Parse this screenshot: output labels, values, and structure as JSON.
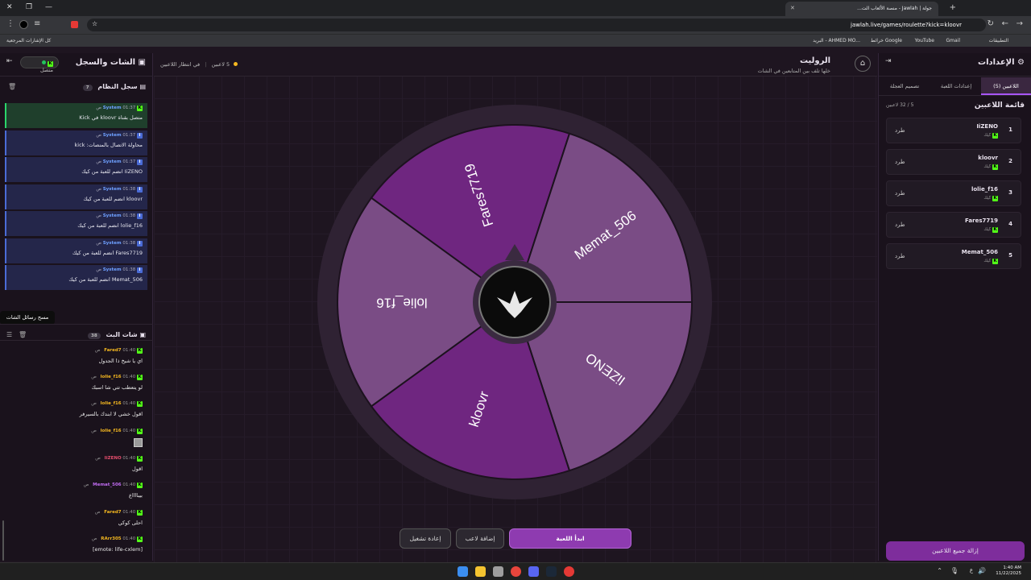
{
  "browser": {
    "tab_title": "جولة | Jawlah - منصة الألعاب الت...",
    "url": "jawlah.live/games/roulette?kick=kloovr",
    "bookmarks": [
      "التطبيقات",
      "Gmail",
      "YouTube",
      "خرائط Google",
      "البريد - AHMED MO..."
    ],
    "bookmarks_left": "كل الإشارات المرجعية"
  },
  "left": {
    "title": "الشات والسجل",
    "connected": "متصل",
    "system_log_title": "سجل النظام",
    "system_log_count": "7",
    "system_messages": [
      {
        "user": "System",
        "time": "01:37 ص",
        "text": "متصل بقناة kloovr في Kick",
        "style": "green"
      },
      {
        "user": "System",
        "time": "01:37 ص",
        "text": "محاولة الاتصال بالمنصات: kick",
        "style": "blue"
      },
      {
        "user": "System",
        "time": "01:37 ص",
        "text": "IiZENO انضم للعبة من كيك",
        "style": "blue"
      },
      {
        "user": "System",
        "time": "01:38 ص",
        "text": "kloovr انضم للعبة من كيك",
        "style": "blue"
      },
      {
        "user": "System",
        "time": "01:38 ص",
        "text": "lolie_f16 انضم للعبة من كيك",
        "style": "blue"
      },
      {
        "user": "System",
        "time": "01:38 ص",
        "text": "Fares7719 انضم للعبة من كيك",
        "style": "blue"
      },
      {
        "user": "System",
        "time": "01:38 ص",
        "text": "Memat_506 انضم للعبة من كيك",
        "style": "blue"
      }
    ],
    "tooltip": "مسح رسائل الشات",
    "live_chat_title": "شات البث",
    "live_chat_count": "38",
    "chat_messages": [
      {
        "user": "Fared7",
        "time": "01:40 ص",
        "text": "اي يا شيخ ذا الجدول",
        "color": "#f5b820"
      },
      {
        "user": "lolie_f16",
        "time": "01:40 ص",
        "text": "لو يتعطب تتي شا اسبك",
        "color": "#f5b820"
      },
      {
        "user": "lolie_f16",
        "time": "01:40 ص",
        "text": "اقول خشي لا ابندك بالسيرفر",
        "color": "#f5b820"
      },
      {
        "user": "lolie_f16",
        "time": "01:40 ص",
        "text": "",
        "color": "#f5b820"
      },
      {
        "user": "IiZENO",
        "time": "01:40 ص",
        "text": "اقول",
        "color": "#e44d6c"
      },
      {
        "user": "Memat_506",
        "time": "01:40 ص",
        "text": "بيبااااع",
        "color": "#c06bf0"
      },
      {
        "user": "Fared7",
        "time": "01:40 ص",
        "text": "احلى كوكي",
        "color": "#f5b820"
      },
      {
        "user": "RArr305",
        "time": "01:40 ص",
        "text": "[emote:  life-cxlem]",
        "color": "#f5b820"
      }
    ]
  },
  "center": {
    "title": "الروليت",
    "subtitle": "خلها تلف بين المتابعين في الشات",
    "players_label": "5 لاعبين",
    "waiting_label": "في انتظار اللاعبين",
    "wheel_names": [
      "Fares7719",
      "Memat_506",
      "IiZENO",
      "kloovr",
      "lolie_f16"
    ],
    "start_button": "ابدأ اللعبة",
    "add_player_button": "إضافة لاعب",
    "restart_button": "إعادة تشغيل"
  },
  "right": {
    "title": "الإعدادات",
    "tabs": [
      "اللاعبين (5)",
      "إعدادات اللعبة",
      "تصميم العجلة"
    ],
    "list_title": "قائمة اللاعبين",
    "list_count": "5 / 32 لاعبين",
    "platform": "كيك",
    "kick_label": "طرد",
    "players": [
      {
        "num": "1",
        "name": "IiZENO"
      },
      {
        "num": "2",
        "name": "kloovr"
      },
      {
        "num": "3",
        "name": "lolie_f16"
      },
      {
        "num": "4",
        "name": "Fares7719"
      },
      {
        "num": "5",
        "name": "Memat_506"
      }
    ],
    "remove_all": "إزالة جميع اللاعبين"
  },
  "taskbar": {
    "time": "1:40 AM",
    "date": "11/22/2025"
  },
  "colors": {
    "accent": "#a855f7",
    "segment_dark": "#6f2680",
    "segment_light": "#7a4c85",
    "kick_green": "#53fc18"
  }
}
